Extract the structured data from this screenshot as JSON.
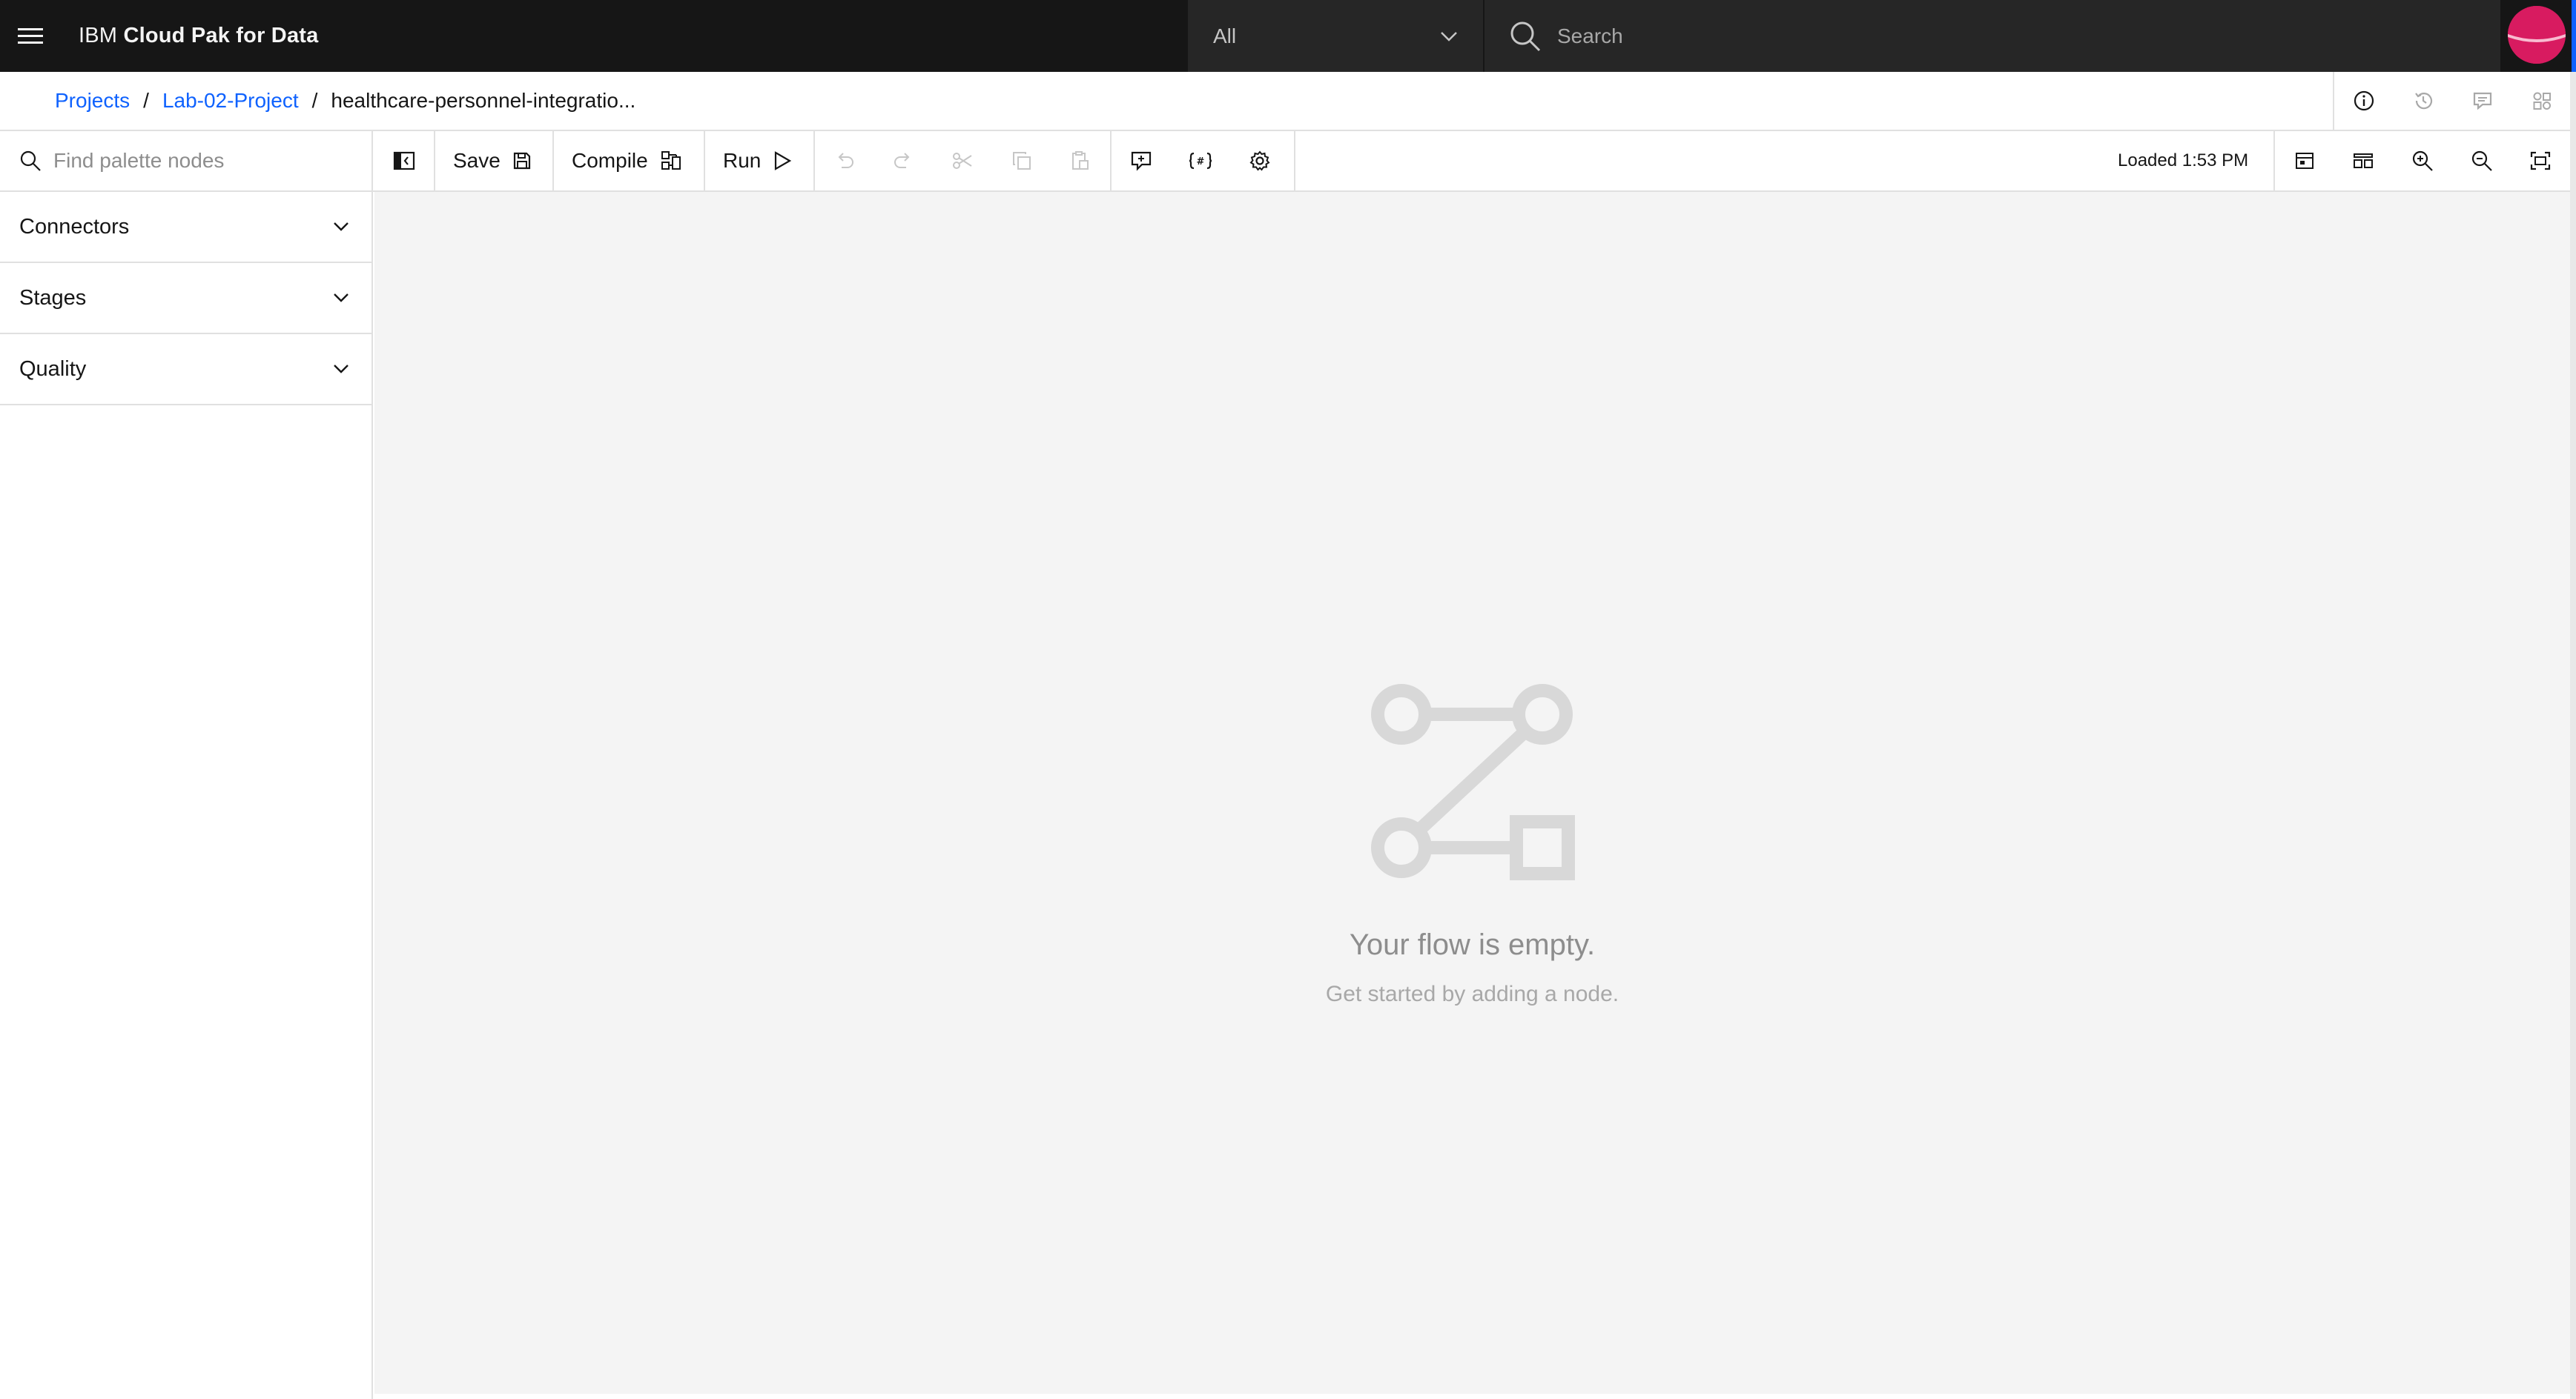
{
  "header": {
    "brand_prefix": "IBM",
    "brand_name": "Cloud Pak for Data",
    "scope_value": "All",
    "search_placeholder": "Search"
  },
  "breadcrumb": {
    "items": [
      "Projects",
      "Lab-02-Project"
    ],
    "separator": "/",
    "current": "healthcare-personnel-integratio..."
  },
  "toolbar": {
    "palette_search_placeholder": "Find palette nodes",
    "save_label": "Save",
    "compile_label": "Compile",
    "run_label": "Run",
    "loaded_status": "Loaded 1:53 PM"
  },
  "palette": {
    "categories": [
      "Connectors",
      "Stages",
      "Quality"
    ]
  },
  "canvas": {
    "empty_title": "Your flow is empty.",
    "empty_subtitle": "Get started by adding a node."
  },
  "colors": {
    "header_bg": "#161616",
    "link": "#0f62fe",
    "canvas_bg": "#f4f4f4",
    "avatar": "#c2185b"
  }
}
